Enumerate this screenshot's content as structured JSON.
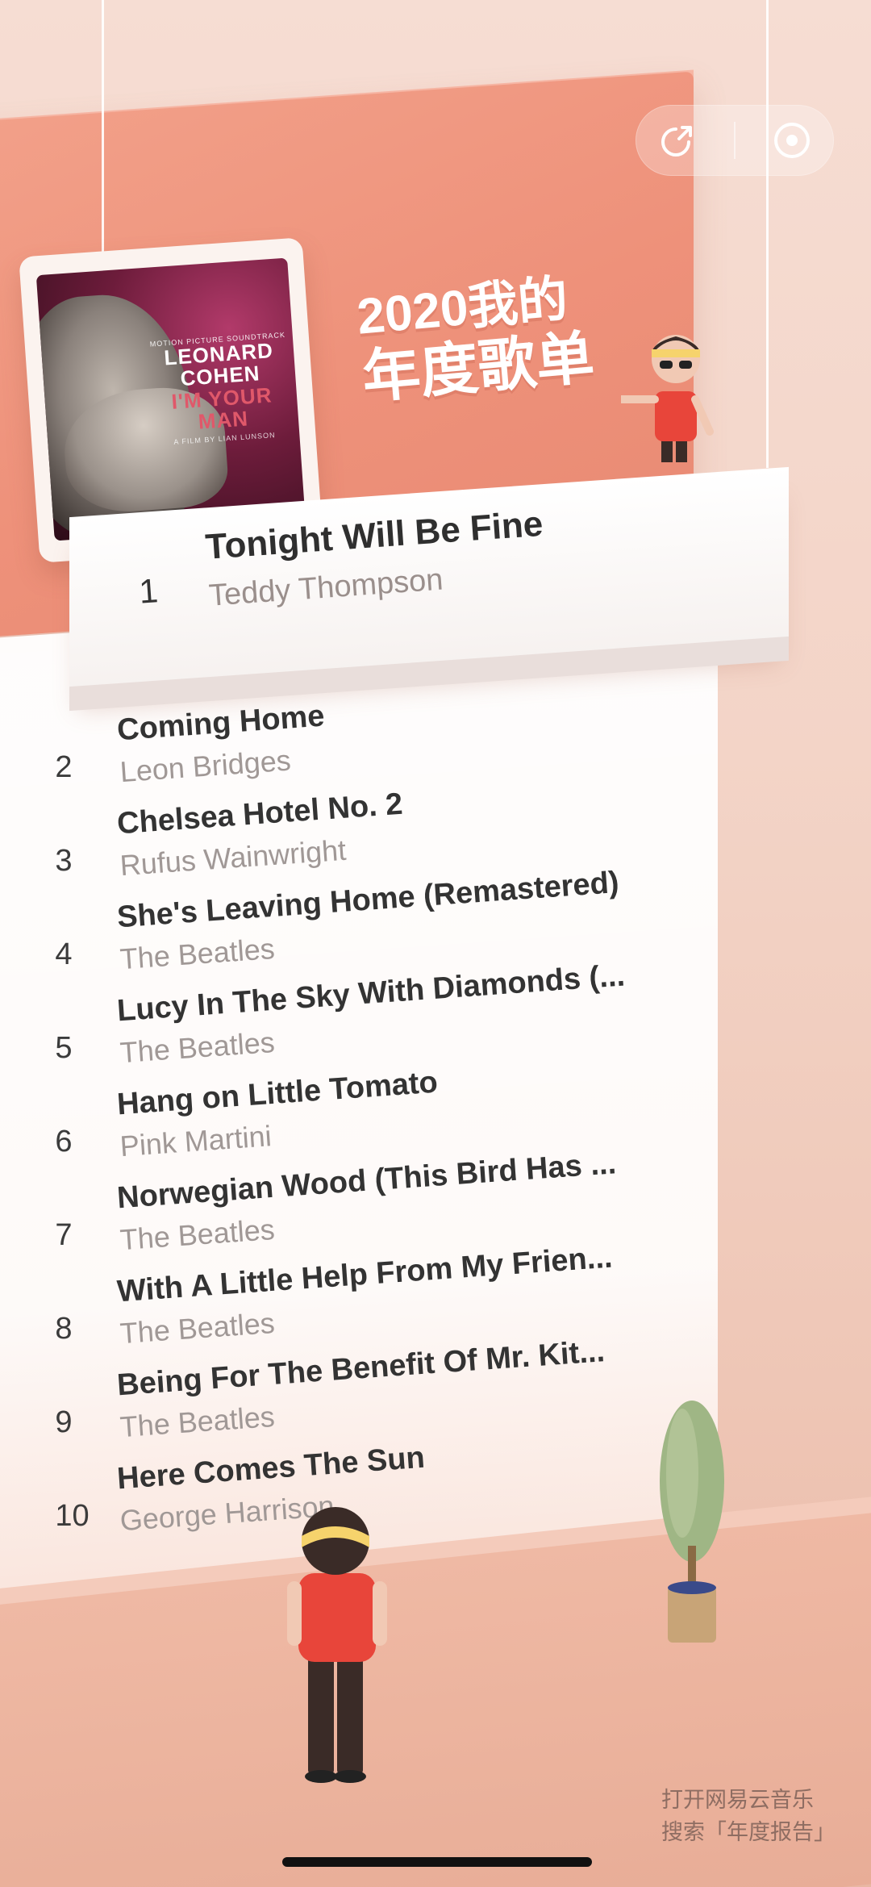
{
  "heading": {
    "line1": "2020我的",
    "line2": "年度歌单"
  },
  "controls": {
    "share_icon": "share-icon",
    "record_icon": "record-icon"
  },
  "album": {
    "small_text": "MOTION PICTURE SOUNDTRACK",
    "artist": "LEONARD COHEN",
    "title": "I'M YOUR MAN",
    "credit": "A FILM BY LIAN LUNSON"
  },
  "top_song": {
    "rank": "1",
    "title": "Tonight Will Be Fine",
    "artist": "Teddy Thompson"
  },
  "songs": [
    {
      "rank": "2",
      "title": "Coming Home",
      "artist": "Leon Bridges"
    },
    {
      "rank": "3",
      "title": "Chelsea Hotel No. 2",
      "artist": "Rufus Wainwright"
    },
    {
      "rank": "4",
      "title": "She's Leaving Home (Remastered)",
      "artist": "The Beatles"
    },
    {
      "rank": "5",
      "title": "Lucy In The Sky With Diamonds (...",
      "artist": "The Beatles"
    },
    {
      "rank": "6",
      "title": "Hang on Little Tomato",
      "artist": "Pink Martini"
    },
    {
      "rank": "7",
      "title": "Norwegian Wood (This Bird Has ...",
      "artist": "The Beatles"
    },
    {
      "rank": "8",
      "title": "With A Little Help From My Frien...",
      "artist": "The Beatles"
    },
    {
      "rank": "9",
      "title": "Being For The Benefit Of Mr. Kit...",
      "artist": "The Beatles"
    },
    {
      "rank": "10",
      "title": "Here Comes The Sun",
      "artist": "George Harrison"
    }
  ],
  "hint": {
    "line1": "打开网易云音乐",
    "line2": "搜索「年度报告」"
  },
  "colors": {
    "accent": "#ee917a",
    "text": "#333333",
    "muted": "#a09896"
  }
}
